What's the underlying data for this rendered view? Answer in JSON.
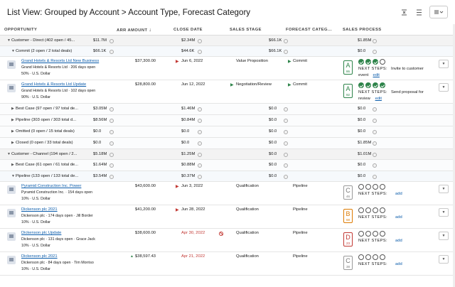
{
  "header": {
    "title": "List View: Grouped by Account > Account Type, Forecast Category",
    "tools": [
      "collapse-all-icon",
      "expand-all-icon",
      "list-settings-icon"
    ]
  },
  "columns": [
    "OPPORTUNITY",
    "ARR AMOUNT",
    "CLOSE DATE",
    "SALES STAGE",
    "FORECAST CATEG...",
    "SALES PROCESS"
  ],
  "rows": [
    {
      "kind": "g1",
      "label": "Customer - Direct (402 open / 45...",
      "amount": "$11.7M",
      "close": "$2.34M",
      "stage": "",
      "forecast": "$66.1K",
      "process": "$1.85M"
    },
    {
      "kind": "g2",
      "label": "Commit (2 open / 2 total deals)",
      "amount": "$66.1K",
      "close": "$44.6K",
      "stage": "",
      "forecast": "$66.1K",
      "process": "$0.0"
    },
    {
      "kind": "rec",
      "name": "Grand Hotels & Resorts Ltd New Business",
      "sub1": "Grand Hotels & Resorts Ltd  ·  206 days open",
      "sub2": "50%  ·  U.S. Dollar",
      "amount": "$37,300.00",
      "amount_flag": "",
      "close": "Jun 6, 2022",
      "close_color": "normal",
      "close_flag": "red-tri",
      "stage": "Value Proposition",
      "stage_flag": "",
      "forecast": "Commit",
      "forecast_flag": "green-tri",
      "grade": "A",
      "grade_score": "86",
      "steps_done": 3,
      "next_label": "NEXT STEPS:",
      "next_text": "Invite to customer",
      "next_text2": "event",
      "next_link": "edit"
    },
    {
      "kind": "rec",
      "name": "Grand Hotels & Resorts Ltd Update",
      "sub1": "Grand Hotels & Resorts Ltd  ·  102 days open",
      "sub2": "90%  ·  U.S. Dollar",
      "amount": "$28,800.00",
      "amount_flag": "",
      "close": "Jun 12, 2022",
      "close_color": "normal",
      "close_flag": "",
      "stage": "Negotiation/Review",
      "stage_flag": "green-tri",
      "forecast": "Commit",
      "forecast_flag": "green-tri",
      "grade": "A",
      "grade_score": "92",
      "steps_done": 4,
      "next_label": "NEXT STEPS:",
      "next_text": "Send proposal for",
      "next_text2": "review",
      "next_link": "edit"
    },
    {
      "kind": "g3",
      "label": "Best Case (97 open / 97 total de...",
      "amount": "$3.05M",
      "close": "$1.46M",
      "forecast": "$0.0",
      "process": "$0.0"
    },
    {
      "kind": "g3",
      "label": "Pipeline (303 open / 303 total d...",
      "amount": "$8.56M",
      "close": "$0.84M",
      "forecast": "$0.0",
      "process": "$0.0"
    },
    {
      "kind": "g3",
      "label": "Omitted (0 open / 15 total deals)",
      "amount": "$0.0",
      "close": "$0.0",
      "forecast": "$0.0",
      "process": "$0.0"
    },
    {
      "kind": "g3",
      "label": "Closed (0 open / 33 total deals)",
      "amount": "$0.0",
      "close": "$0.0",
      "forecast": "$0.0",
      "process": "$1.85M"
    },
    {
      "kind": "g1",
      "label": "Customer - Channel (194 open / 2...",
      "amount": "$5.18M",
      "close": "$1.25M",
      "stage": "",
      "forecast": "$0.0",
      "process": "$1.01M"
    },
    {
      "kind": "g3",
      "label": "Best Case (61 open / 61 total de...",
      "amount": "$1.64M",
      "close": "$0.88M",
      "forecast": "$0.0",
      "process": "$0.0"
    },
    {
      "kind": "g2",
      "label": "Pipeline (133 open / 133 total de...",
      "amount": "$3.54M",
      "close": "$0.37M",
      "stage": "",
      "forecast": "$0.0",
      "process": "$0.0"
    },
    {
      "kind": "rec",
      "name": "Pyramid Construction Inc. Power",
      "sub1": "Pyramid Construction Inc.  ·  154 days open",
      "sub2": "10%  ·  U.S. Dollar",
      "amount": "$43,600.00",
      "amount_flag": "",
      "close": "Jun 3, 2022",
      "close_color": "normal",
      "close_flag": "red-tri",
      "stage": "Qualification",
      "stage_flag": "",
      "forecast": "Pipeline",
      "forecast_flag": "",
      "grade": "C",
      "grade_score": "46",
      "steps_done": 0,
      "next_label": "NEXT STEPS:",
      "next_text": "",
      "next_text2": "",
      "next_link": "add"
    },
    {
      "kind": "rec",
      "name": "Dickenson plc 2021",
      "sub1": "Dickenson plc  ·  174 days open  ·  Jill Border",
      "sub2": "10%  ·  U.S. Dollar",
      "amount": "$41,200.00",
      "amount_flag": "",
      "close": "Jun 28, 2022",
      "close_color": "normal",
      "close_flag": "red-tri",
      "stage": "Qualification",
      "stage_flag": "",
      "forecast": "Pipeline",
      "forecast_flag": "",
      "grade": "B",
      "grade_score": "68",
      "steps_done": 0,
      "next_label": "NEXT STEPS:",
      "next_text": "",
      "next_text2": "",
      "next_link": "add"
    },
    {
      "kind": "rec",
      "name": "Dickenson plc Update",
      "sub1": "Dickenson plc  ·  131 days open  ·  Grace Jack",
      "sub2": "10%  ·  U.S. Dollar",
      "amount": "$38,600.00",
      "amount_flag": "",
      "close": "Apr 30, 2022",
      "close_color": "red",
      "close_flag": "warn",
      "stage": "Qualification",
      "stage_flag": "",
      "forecast": "Pipeline",
      "forecast_flag": "",
      "grade": "D",
      "grade_score": "23",
      "steps_done": 0,
      "next_label": "NEXT STEPS:",
      "next_text": "",
      "next_text2": "",
      "next_link": "add"
    },
    {
      "kind": "rec",
      "name": "Dickenson plc 2021",
      "sub1": "Dickenson plc  ·  84 days open  ·  Tim Morriso",
      "sub2": "10%  ·  U.S. Dollar",
      "amount": "$38,597.43",
      "amount_flag": "green-up",
      "close": "Apr 21, 2022",
      "close_color": "red",
      "close_flag": "",
      "stage": "Qualification",
      "stage_flag": "",
      "forecast": "Pipeline",
      "forecast_flag": "",
      "grade": "C",
      "grade_score": "38",
      "steps_done": 0,
      "next_label": "NEXT STEPS:",
      "next_text": "",
      "next_text2": "",
      "next_link": "add"
    }
  ],
  "colors": {
    "accent": "#0b5cab",
    "green": "#2e844a",
    "red": "#c23934",
    "orange": "#dd7a01"
  }
}
